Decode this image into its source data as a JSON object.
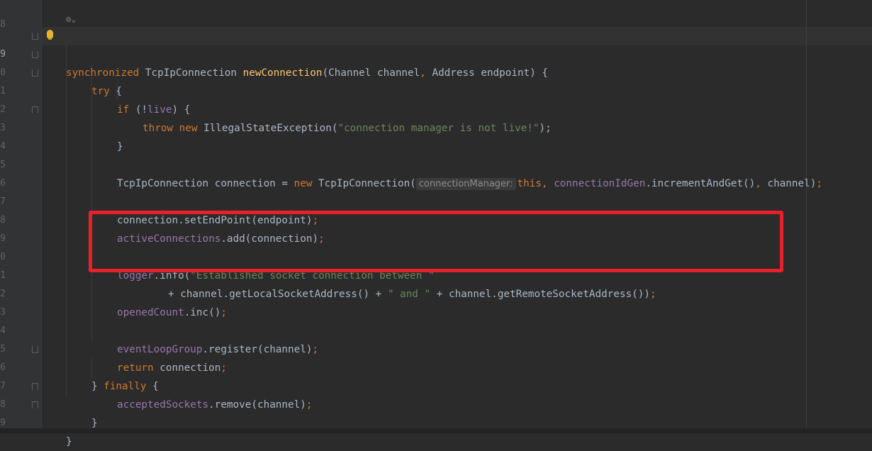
{
  "editor": {
    "accent_highlight_color": "#e8202a",
    "gutter": {
      "line_numbers": [
        "8",
        "9",
        "0",
        "1",
        "2",
        "3",
        "4",
        "5",
        "6",
        "7",
        "8",
        "9",
        "0",
        "1",
        "2",
        "3",
        "4",
        "5",
        "6",
        "7",
        "8",
        "9"
      ]
    },
    "code": {
      "l1_kw": "synchronized",
      "l1_type": " TcpIpConnection ",
      "l1_fn": "newConnection",
      "l1_params_a": "(Channel channel",
      "l1_comma": ",",
      "l1_params_b": " Address endpoint) {",
      "l2_kw": "try",
      "l2_rest": " {",
      "l3_kw": "if",
      "l3_a": " (!",
      "l3_field": "live",
      "l3_b": ") {",
      "l4_kw1": "throw",
      "l4_kw2": "new",
      "l4_type": " IllegalStateException(",
      "l4_str": "\"connection manager is not live!\"",
      "l4_end": ");",
      "l5": "}",
      "l7_a": "TcpIpConnection connection = ",
      "l7_kw": "new",
      "l7_b": " TcpIpConnection(",
      "l7_inlay": "connectionManager:",
      "l7_this": "this",
      "l7_comma1": ",",
      "l7_field": "connectionIdGen",
      "l7_c": ".incrementAndGet()",
      "l7_comma2": ",",
      "l7_d": " channel)",
      "l7_semi": ";",
      "l9_a": "connection.setEndPoint(endpoint)",
      "l9_semi": ";",
      "l10_field": "activeConnections",
      "l10_a": ".add(connection)",
      "l10_semi": ";",
      "l12_field": "logger",
      "l12_a": ".info(",
      "l12_str": "\"Established socket connection between \"",
      "l13_a": "+ channel.getLocalSocketAddress() + ",
      "l13_str": "\" and \"",
      "l13_b": " + channel.getRemoteSocketAddress())",
      "l13_semi": ";",
      "l14_field": "openedCount",
      "l14_a": ".inc()",
      "l14_semi": ";",
      "l16_field": "eventLoopGroup",
      "l16_a": ".register(channel)",
      "l16_semi": ";",
      "l17_kw": "return",
      "l17_a": " connection",
      "l17_semi": ";",
      "l18_a": "} ",
      "l18_kw": "finally",
      "l18_b": " {",
      "l19_field": "acceptedSockets",
      "l19_a": ".remove(channel)",
      "l19_semi": ";",
      "l20": "}",
      "l21": "}"
    }
  }
}
